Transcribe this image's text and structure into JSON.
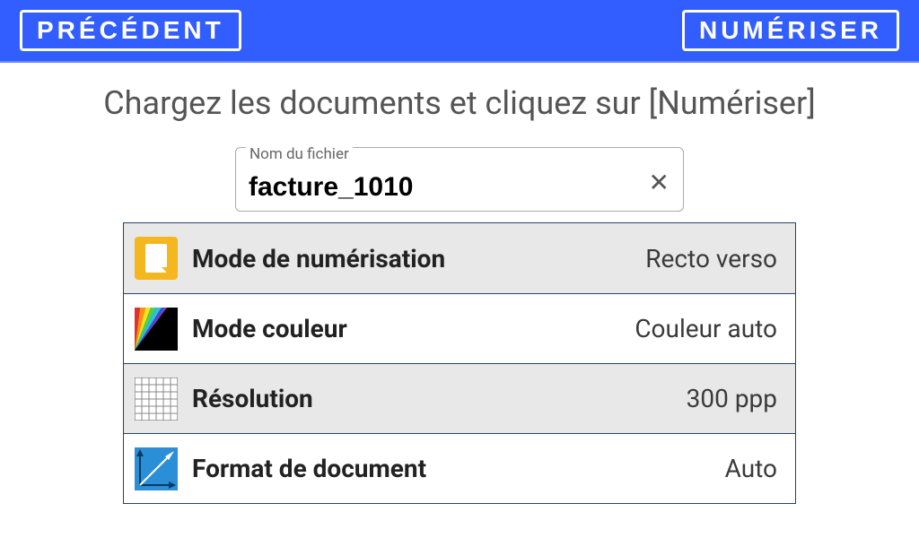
{
  "header": {
    "back": "PRÉCÉDENT",
    "scan": "NUMÉRISER"
  },
  "instruction": "Chargez les documents et cliquez sur [Numériser]",
  "filename": {
    "label": "Nom du fichier",
    "value": "facture_1010"
  },
  "settings": [
    {
      "key": "scan_mode",
      "label": "Mode de numérisation",
      "value": "Recto verso"
    },
    {
      "key": "color_mode",
      "label": "Mode couleur",
      "value": "Couleur auto"
    },
    {
      "key": "resolution",
      "label": "Résolution",
      "value": "300 ppp"
    },
    {
      "key": "doc_format",
      "label": "Format de document",
      "value": "Auto"
    }
  ]
}
